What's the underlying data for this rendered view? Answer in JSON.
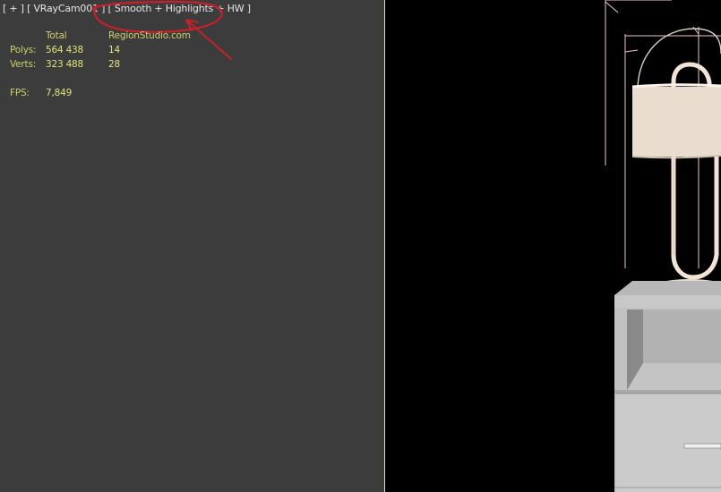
{
  "viewport": {
    "menu_plus": "[ + ]",
    "camera": "[ VRayCam001 ]",
    "shading": "[ Smooth + Highlights + HW ]"
  },
  "stats": {
    "header": {
      "label": "",
      "total": "Total",
      "selection": "RegionStudio.com"
    },
    "polys": {
      "label": "Polys:",
      "total": "564 438",
      "selection": "14"
    },
    "verts": {
      "label": "Verts:",
      "total": "323 488",
      "selection": "28"
    },
    "fps": {
      "label": "FPS:",
      "value": "7,849"
    }
  },
  "colors": {
    "viewport_bg_left": "#3c3c3c",
    "viewport_bg_right": "#000000",
    "stats_text": "#e3e37a",
    "annotation": "#c8202a",
    "selection_box": "#f0c8d0"
  }
}
